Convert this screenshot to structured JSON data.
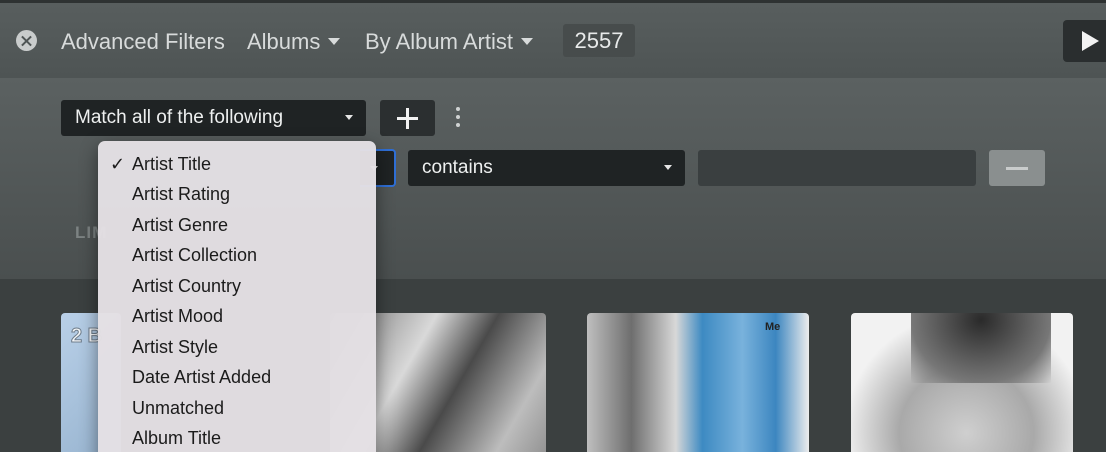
{
  "topbar": {
    "title": "Advanced Filters",
    "library_type": "Albums",
    "sort": "By Album Artist",
    "count": "2557"
  },
  "filter": {
    "match_mode": "Match all of the following",
    "operator": "contains",
    "value": "",
    "limit_label_partial": "LIM"
  },
  "field_menu": {
    "items": [
      {
        "label": "Artist Title",
        "checked": true
      },
      {
        "label": "Artist Rating"
      },
      {
        "label": "Artist Genre"
      },
      {
        "label": "Artist Collection"
      },
      {
        "label": "Artist Country"
      },
      {
        "label": "Artist Mood"
      },
      {
        "label": "Artist Style"
      },
      {
        "label": "Date Artist Added"
      },
      {
        "label": "Unmatched"
      },
      {
        "label": "Album Title"
      }
    ],
    "check_glyph": "✓"
  },
  "albums": {
    "thumb1_text": "2 B",
    "thumb3_tag": "Me"
  },
  "colors": {
    "accent_focus": "#2f6fd6",
    "menu_bg": "#e4e0e4"
  }
}
